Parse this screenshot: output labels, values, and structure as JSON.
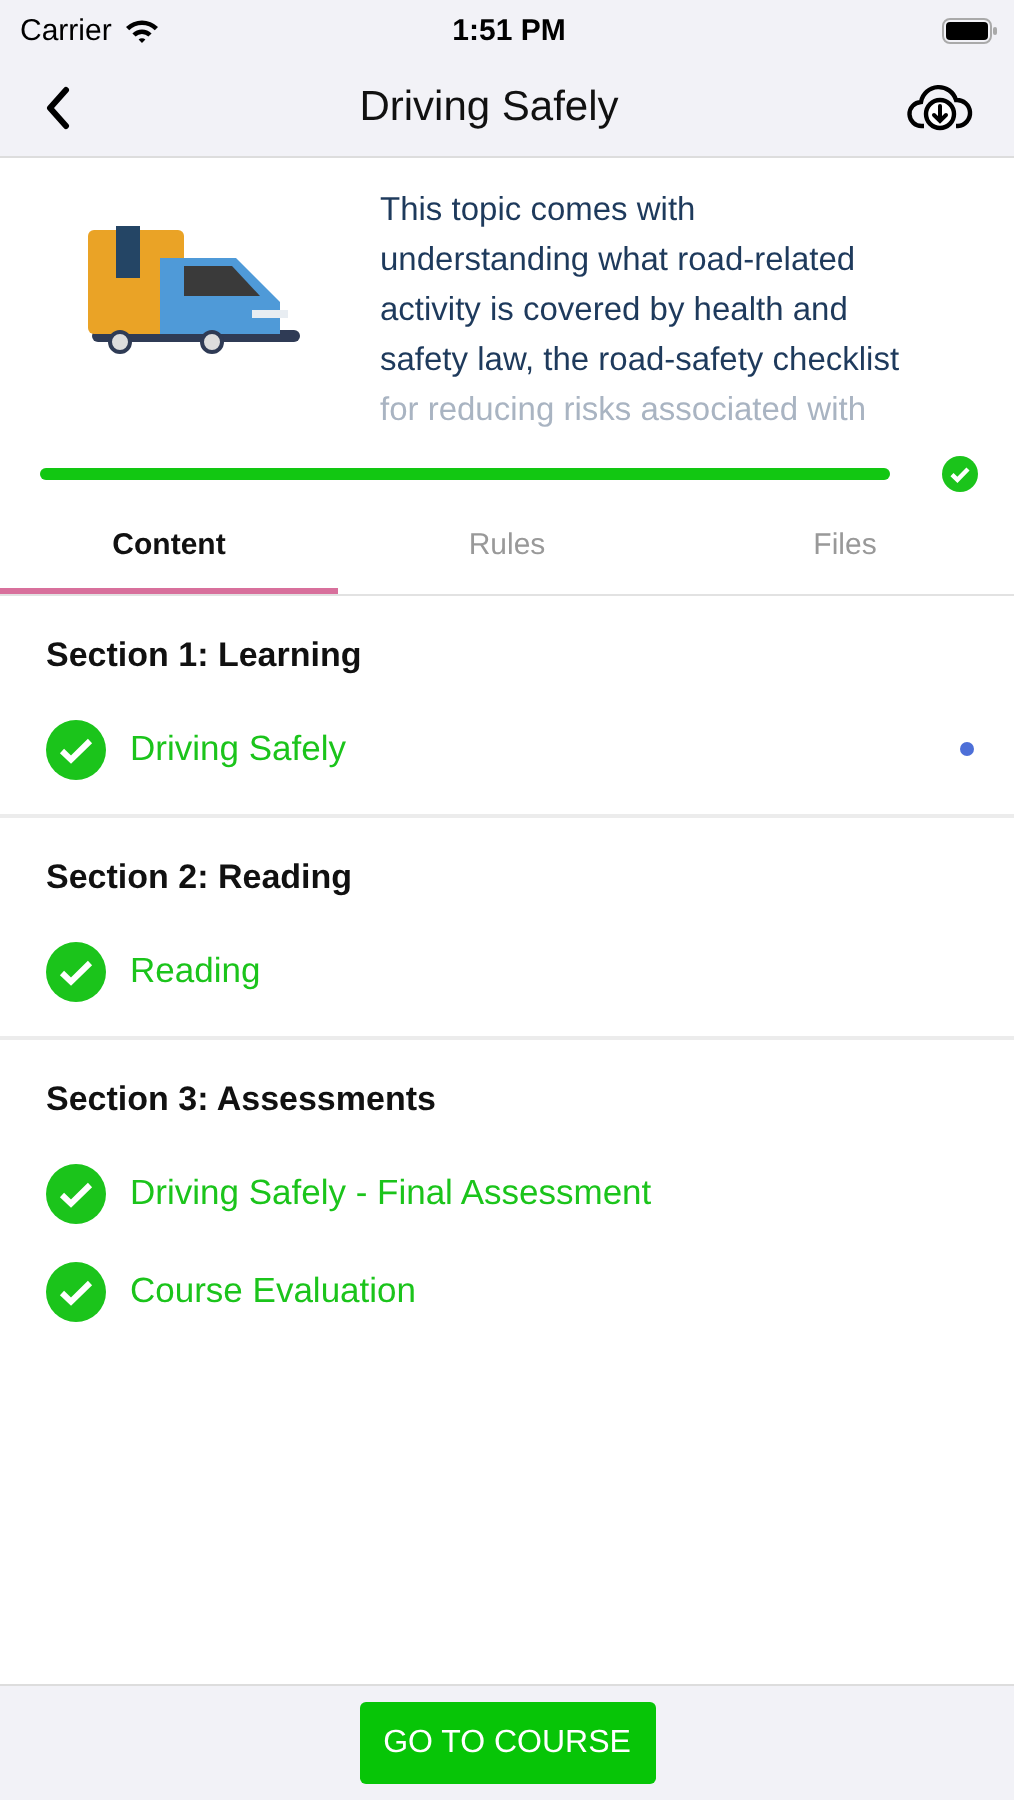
{
  "status_bar": {
    "carrier": "Carrier",
    "time": "1:51 PM"
  },
  "nav": {
    "title": "Driving Safely"
  },
  "intro": {
    "lines": [
      "This topic comes with",
      "understanding what road-related",
      "activity is covered by health and",
      "safety law, the road-safety checklist"
    ],
    "faded_line": "for reducing risks associated with"
  },
  "progress": {
    "level": 1,
    "complete": true
  },
  "tabs": [
    {
      "label": "Content",
      "selected": true
    },
    {
      "label": "Rules",
      "selected": false
    },
    {
      "label": "Files",
      "selected": false
    }
  ],
  "sections": [
    {
      "title": "Section 1: Learning",
      "items": [
        {
          "label": "Driving Safely",
          "completed": true,
          "current": true
        }
      ]
    },
    {
      "title": "Section 2: Reading",
      "items": [
        {
          "label": "Reading",
          "completed": true,
          "current": false
        }
      ]
    },
    {
      "title": "Section 3: Assessments",
      "items": [
        {
          "label": "Driving Safely - Final Assessment",
          "completed": true,
          "current": false
        },
        {
          "label": "Course Evaluation",
          "completed": true,
          "current": false
        }
      ]
    }
  ],
  "footer": {
    "button": "GO TO COURSE"
  }
}
